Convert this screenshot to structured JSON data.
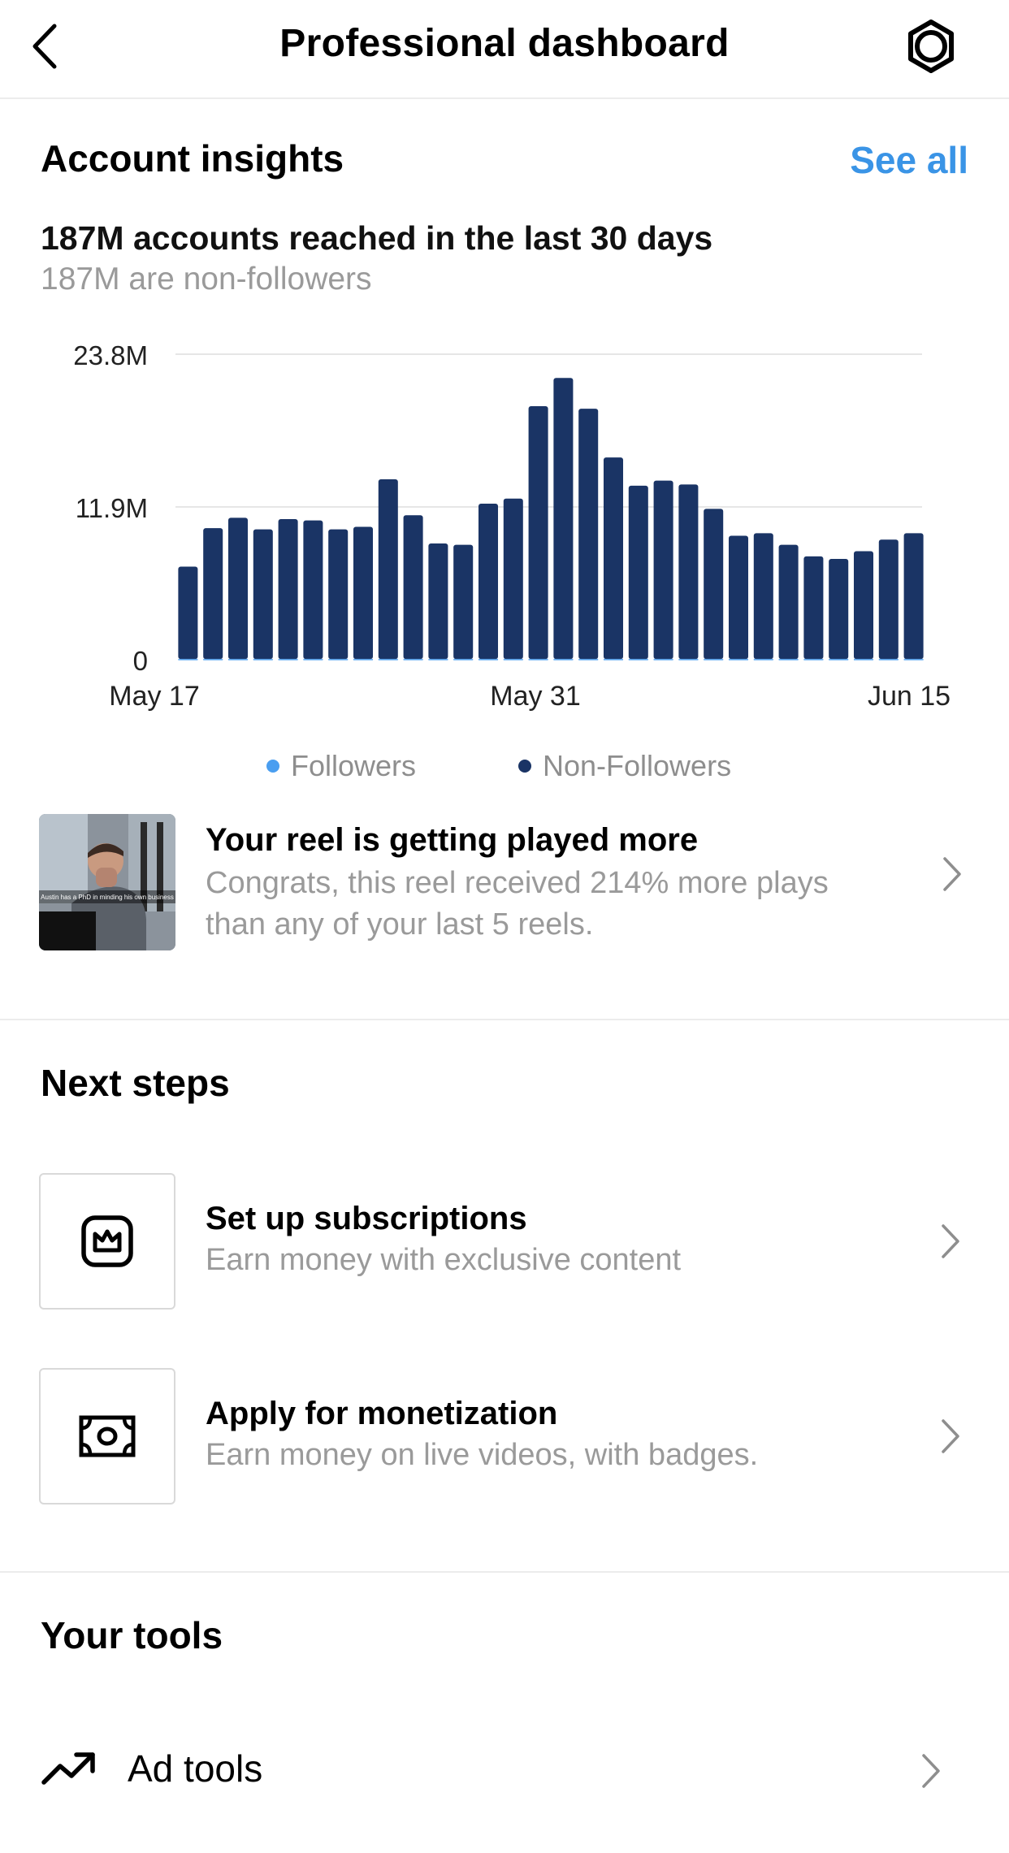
{
  "nav": {
    "title": "Professional dashboard"
  },
  "insights": {
    "title": "Account insights",
    "see_all": "See all",
    "reach": "187M accounts reached in the last 30 days",
    "non_followers": "187M are non-followers"
  },
  "chart_data": {
    "type": "bar",
    "stacked": true,
    "y_ticks": [
      "23.8M",
      "11.9M",
      "0"
    ],
    "ylim": [
      0,
      23.8
    ],
    "x_labels": [
      "May 17",
      "May 31",
      "Jun 15"
    ],
    "legend": [
      "Followers",
      "Non-Followers"
    ],
    "legend_placement": "bottom",
    "grid": true,
    "colors": {
      "followers": "#4a9ef0",
      "non_followers": "#1a3465"
    },
    "series": [
      {
        "name": "Followers",
        "values": [
          0.05,
          0.05,
          0.05,
          0.05,
          0.05,
          0.05,
          0.05,
          0.05,
          0.05,
          0.05,
          0.05,
          0.05,
          0.05,
          0.05,
          0.05,
          0.05,
          0.05,
          0.05,
          0.05,
          0.05,
          0.05,
          0.05,
          0.05,
          0.05,
          0.05,
          0.05,
          0.05,
          0.05,
          0.05,
          0.05
        ]
      },
      {
        "name": "Non-Followers",
        "values": [
          7.2,
          10.2,
          11.0,
          10.1,
          10.9,
          10.8,
          10.1,
          10.3,
          14.0,
          11.2,
          9.0,
          8.9,
          12.1,
          12.5,
          19.7,
          21.9,
          19.5,
          15.7,
          13.5,
          13.9,
          13.6,
          11.7,
          9.6,
          9.8,
          8.9,
          8.0,
          7.8,
          8.4,
          9.3,
          9.8
        ]
      }
    ]
  },
  "reel_insight": {
    "title": "Your reel is getting played more",
    "description": "Congrats, this reel received 214% more plays than any of your last 5 reels.",
    "thumb_caption": "Austin has a PhD in minding his own business"
  },
  "next_steps": {
    "title": "Next steps",
    "items": [
      {
        "title": "Set up subscriptions",
        "subtitle": "Earn money with exclusive content",
        "icon": "crown-icon"
      },
      {
        "title": "Apply for monetization",
        "subtitle": "Earn money on live videos, with badges.",
        "icon": "money-icon"
      }
    ]
  },
  "tools": {
    "title": "Your tools",
    "items": [
      {
        "label": "Ad tools",
        "icon": "trending-up-icon"
      }
    ]
  }
}
